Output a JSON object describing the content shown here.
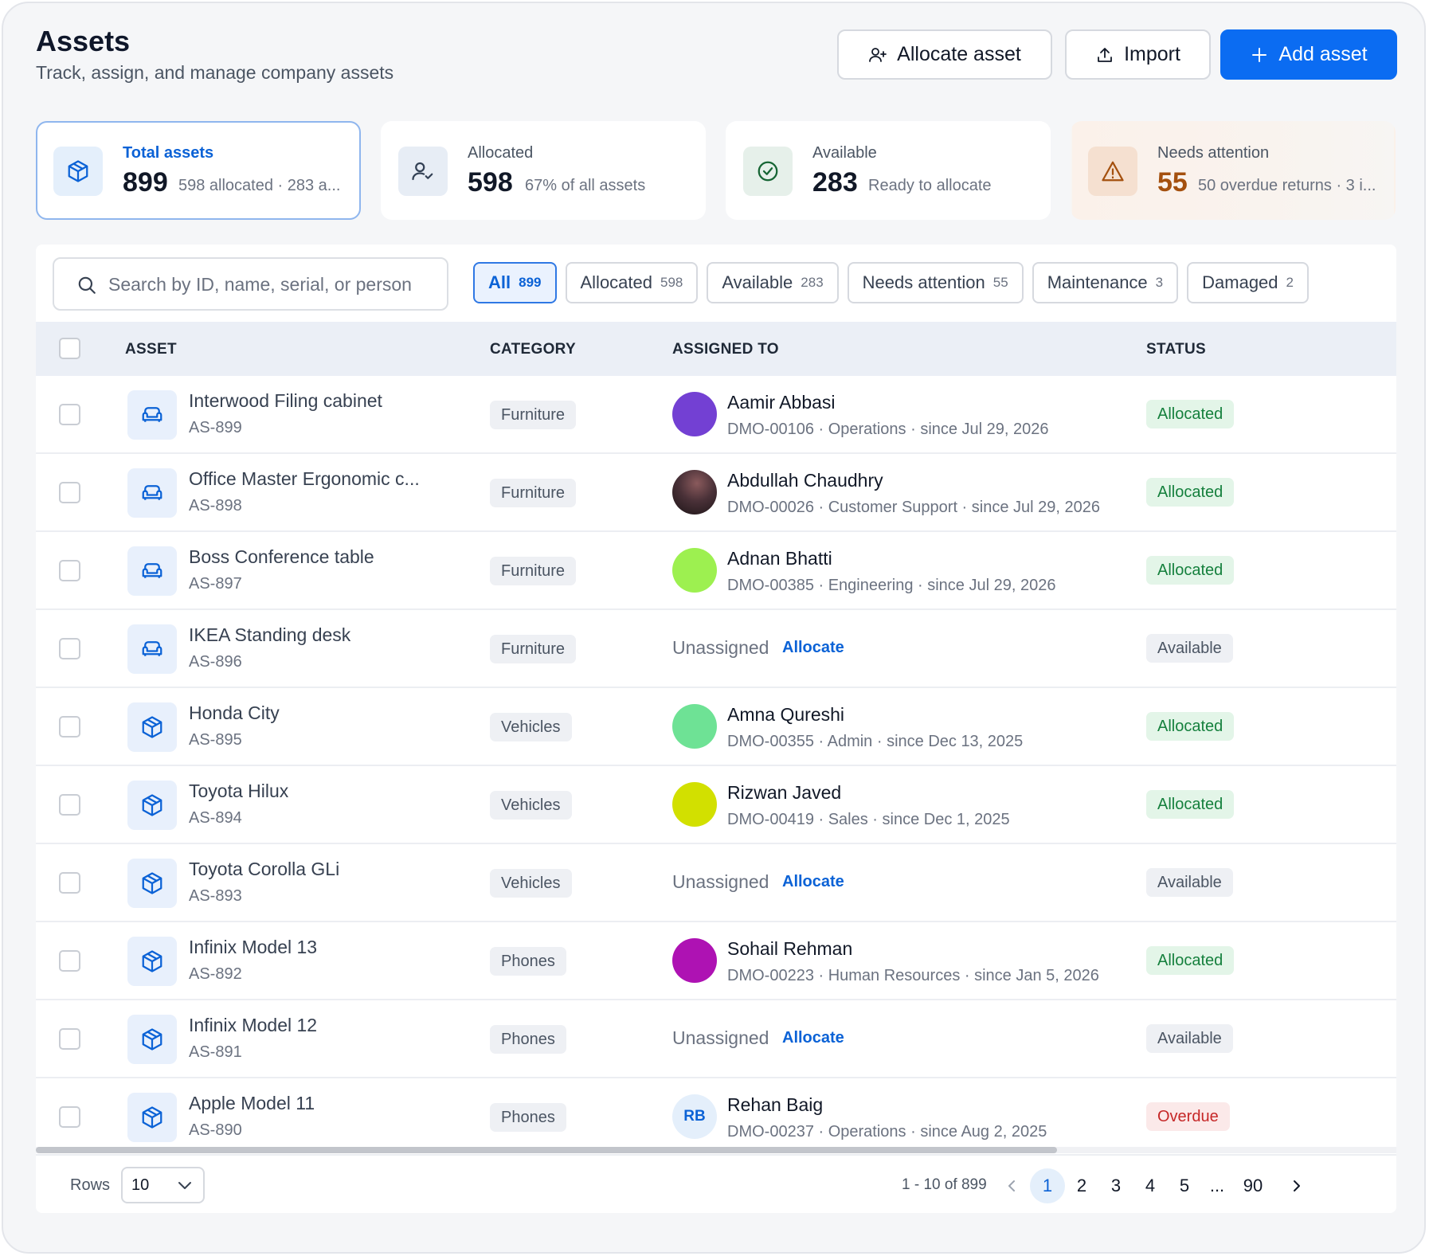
{
  "header": {
    "title": "Assets",
    "subtitle": "Track, assign, and manage company assets",
    "allocate_label": "Allocate asset",
    "import_label": "Import",
    "add_label": "Add asset"
  },
  "stats": [
    {
      "label": "Total assets",
      "value": "899",
      "sub": "598 allocated · 283 a..."
    },
    {
      "label": "Allocated",
      "value": "598",
      "sub": "67% of all assets"
    },
    {
      "label": "Available",
      "value": "283",
      "sub": "Ready to allocate"
    },
    {
      "label": "Needs attention",
      "value": "55",
      "sub": "50 overdue returns · 3 i..."
    }
  ],
  "search": {
    "placeholder": "Search by ID, name, serial, or person"
  },
  "filters": [
    {
      "label": "All",
      "count": "899"
    },
    {
      "label": "Allocated",
      "count": "598"
    },
    {
      "label": "Available",
      "count": "283"
    },
    {
      "label": "Needs attention",
      "count": "55"
    },
    {
      "label": "Maintenance",
      "count": "3"
    },
    {
      "label": "Damaged",
      "count": "2"
    }
  ],
  "table": {
    "columns": {
      "asset": "ASSET",
      "category": "CATEGORY",
      "assigned": "ASSIGNED TO",
      "status": "STATUS"
    },
    "unassigned_text": "Unassigned",
    "allocate_link": "Allocate",
    "rows": [
      {
        "name": "Interwood Filing cabinet",
        "id": "AS-899",
        "category": "Furniture",
        "person": "Aamir Abbasi",
        "meta": "DMO-00106 · Operations · since Jul 29, 2026",
        "status": "Allocated"
      },
      {
        "name": "Office Master Ergonomic c...",
        "id": "AS-898",
        "category": "Furniture",
        "person": "Abdullah Chaudhry",
        "meta": "DMO-00026 · Customer Support · since Jul 29, 2026",
        "status": "Allocated"
      },
      {
        "name": "Boss Conference table",
        "id": "AS-897",
        "category": "Furniture",
        "person": "Adnan Bhatti",
        "meta": "DMO-00385 · Engineering · since Jul 29, 2026",
        "status": "Allocated"
      },
      {
        "name": "IKEA Standing desk",
        "id": "AS-896",
        "category": "Furniture",
        "person": "",
        "meta": "",
        "status": "Available"
      },
      {
        "name": "Honda City",
        "id": "AS-895",
        "category": "Vehicles",
        "person": "Amna Qureshi",
        "meta": "DMO-00355 · Admin · since Dec 13, 2025",
        "status": "Allocated"
      },
      {
        "name": "Toyota Hilux",
        "id": "AS-894",
        "category": "Vehicles",
        "person": "Rizwan Javed",
        "meta": "DMO-00419 · Sales · since Dec 1, 2025",
        "status": "Allocated"
      },
      {
        "name": "Toyota Corolla GLi",
        "id": "AS-893",
        "category": "Vehicles",
        "person": "",
        "meta": "",
        "status": "Available"
      },
      {
        "name": "Infinix Model 13",
        "id": "AS-892",
        "category": "Phones",
        "person": "Sohail Rehman",
        "meta": "DMO-00223 · Human Resources · since Jan 5, 2026",
        "status": "Allocated"
      },
      {
        "name": "Infinix Model 12",
        "id": "AS-891",
        "category": "Phones",
        "person": "",
        "meta": "",
        "status": "Available"
      },
      {
        "name": "Apple Model 11",
        "id": "AS-890",
        "category": "Phones",
        "person": "Rehan Baig",
        "initials": "RB",
        "meta": "DMO-00237 · Operations · since Aug 2, 2025",
        "status": "Overdue"
      }
    ]
  },
  "avatar_colors": [
    "#7340d3",
    "#3b2a2e",
    "#9df050",
    "",
    "#6ee295",
    "#d2e000",
    "",
    "#ae12b3",
    "",
    ""
  ],
  "footer": {
    "rows_label": "Rows",
    "rows_value": "10",
    "range": "1 - 10 of 899",
    "pages": [
      "1",
      "2",
      "3",
      "4",
      "5",
      "...",
      "90"
    ]
  },
  "colors": {
    "primary": "#0b6cf2",
    "allocated": "#15803d",
    "overdue": "#c62828",
    "attention": "#a4500e"
  }
}
